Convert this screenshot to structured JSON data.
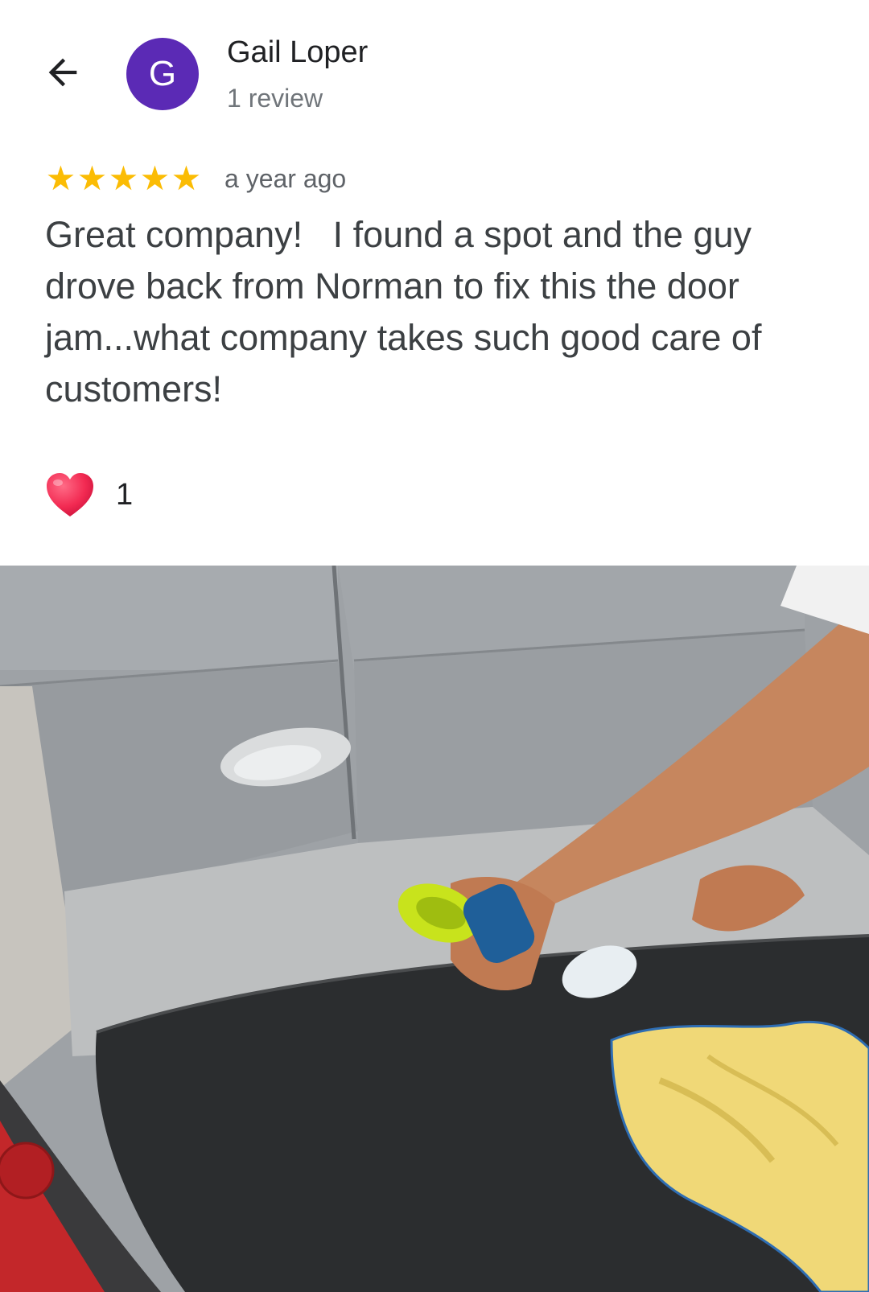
{
  "header": {
    "back_icon": "arrow-back-icon",
    "avatar_initial": "G",
    "avatar_color": "#5b2ab5",
    "author_name": "Gail Loper",
    "review_count": "1 review"
  },
  "review": {
    "rating": 5,
    "rating_max": 5,
    "star_icon": "star-icon",
    "star_color": "#fbbc04",
    "timestamp": "a year ago",
    "text": "Great company!   I found a spot and the guy drove back from Norman to fix this the door jam...what company takes such good care of customers!"
  },
  "reaction": {
    "icon": "heart-icon",
    "count": "1"
  },
  "photo": {
    "subject": "review-photo"
  }
}
